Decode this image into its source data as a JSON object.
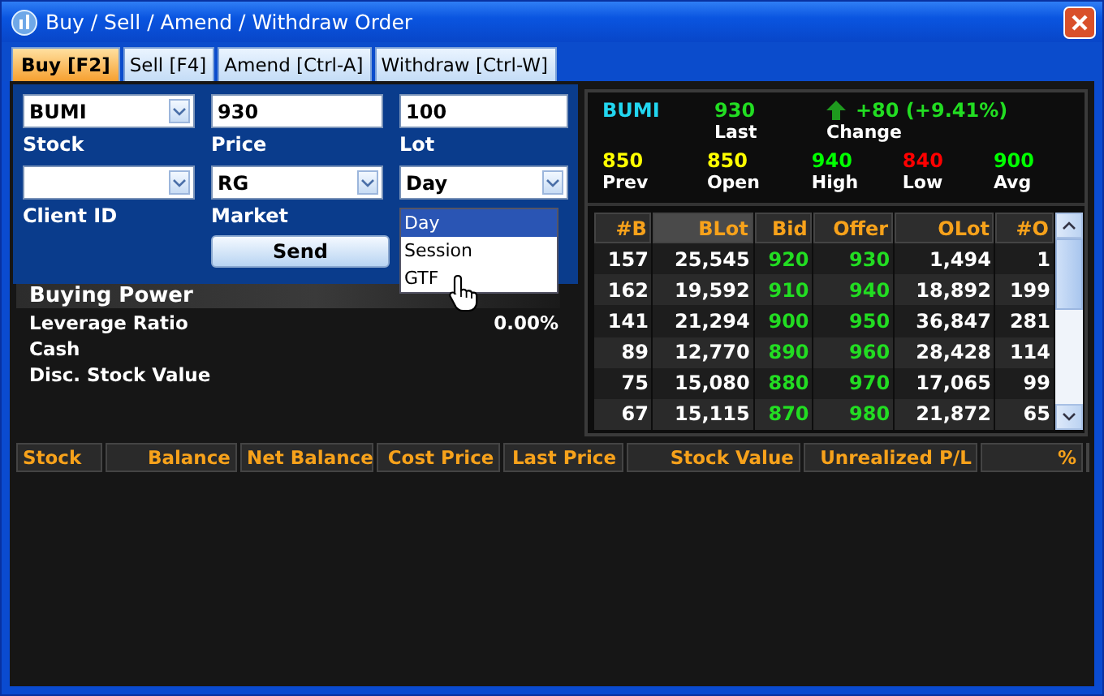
{
  "window": {
    "title": "Buy / Sell / Amend / Withdraw Order"
  },
  "tabs": [
    {
      "label": "Buy [F2]",
      "selected": true
    },
    {
      "label": "Sell [F4]",
      "selected": false
    },
    {
      "label": "Amend [Ctrl-A]",
      "selected": false
    },
    {
      "label": "Withdraw [Ctrl-W]",
      "selected": false
    }
  ],
  "order_form": {
    "fields": [
      {
        "label": "Stock",
        "value": "BUMI",
        "kind": "dropdown"
      },
      {
        "label": "Price",
        "value": "930",
        "kind": "text"
      },
      {
        "label": "Lot",
        "value": "100",
        "kind": "text"
      },
      {
        "label": "Client ID",
        "kind": "dropdown"
      },
      {
        "label": "Market",
        "value": "RG",
        "kind": "dropdown"
      },
      {
        "value": "Day",
        "kind": "dropdown",
        "expanded": true,
        "options": [
          {
            "label": "Day",
            "selected": true
          },
          {
            "label": "Session",
            "selected": false
          },
          {
            "label": "GTF",
            "selected": false
          }
        ]
      }
    ],
    "send_button": "Send"
  },
  "buying_power": {
    "title": "Buying Power",
    "rows": [
      {
        "label": "Leverage Ratio",
        "value": "0.00%"
      },
      {
        "label": "Cash"
      },
      {
        "label": "Disc. Stock Value"
      }
    ]
  },
  "quote": {
    "symbol": "BUMI",
    "last": {
      "value": "930",
      "label": "Last"
    },
    "change": {
      "value": "+80 (+9.41%)",
      "label": "Change",
      "rising": true
    },
    "stats": [
      {
        "value": "850",
        "label": "Prev",
        "color": "#ffff00"
      },
      {
        "value": "850",
        "label": "Open",
        "color": "#ffff00"
      },
      {
        "value": "940",
        "label": "High",
        "color": "#00ff00"
      },
      {
        "value": "840",
        "label": "Low",
        "color": "#ff0000"
      },
      {
        "value": "900",
        "label": "Avg",
        "color": "#00ff00"
      }
    ]
  },
  "depth": {
    "columns": [
      "#B",
      "BLot",
      "Bid",
      "Offer",
      "OLot",
      "#O"
    ],
    "rows": [
      [
        "157",
        "25,545",
        "920",
        "930",
        "1,494",
        "1"
      ],
      [
        "162",
        "19,592",
        "910",
        "940",
        "18,892",
        "199"
      ],
      [
        "141",
        "21,294",
        "900",
        "950",
        "36,847",
        "281"
      ],
      [
        "89",
        "12,770",
        "890",
        "960",
        "28,428",
        "114"
      ],
      [
        "75",
        "15,080",
        "880",
        "970",
        "17,065",
        "99"
      ],
      [
        "67",
        "15,115",
        "870",
        "980",
        "21,872",
        "65"
      ]
    ]
  },
  "portfolio": {
    "columns": [
      "Stock",
      "Balance",
      "Net Balance",
      "Cost Price",
      "Last Price",
      "Stock Value",
      "Unrealized P/L",
      "%"
    ]
  }
}
